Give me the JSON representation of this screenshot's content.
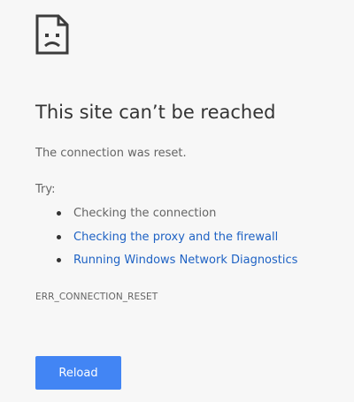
{
  "error": {
    "icon": "sad-page-icon",
    "title": "This site can’t be reached",
    "subtitle": "The connection was reset.",
    "try_label": "Try:",
    "suggestions": [
      {
        "text": "Checking the connection",
        "is_link": false
      },
      {
        "text": "Checking the proxy and the firewall",
        "is_link": true
      },
      {
        "text": "Running Windows Network Diagnostics",
        "is_link": true
      }
    ],
    "error_code": "ERR_CONNECTION_RESET",
    "reload_label": "Reload"
  },
  "colors": {
    "background": "#f7f7f7",
    "link": "#1e62c4",
    "button": "#4285f4"
  }
}
